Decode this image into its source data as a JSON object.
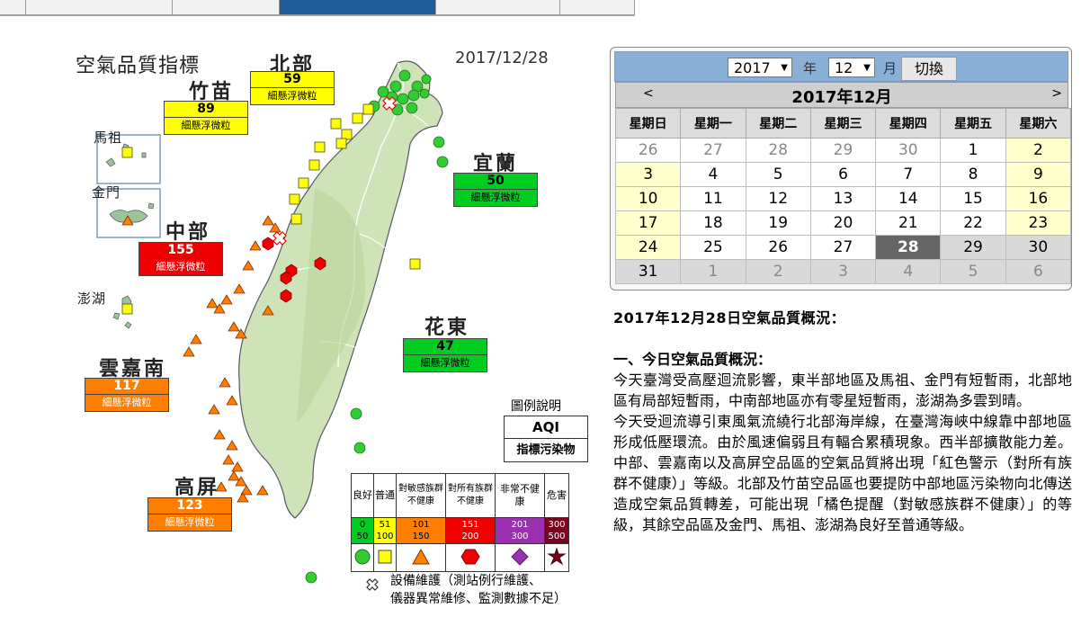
{
  "map": {
    "title": "空氣品質指標",
    "date": "2017/12/28",
    "regions": {
      "north": {
        "name": "北部",
        "aqi": "59",
        "pollutant": "細懸浮微粒"
      },
      "zhumiao": {
        "name": "竹苗",
        "aqi": "89",
        "pollutant": "細懸浮微粒"
      },
      "yilan": {
        "name": "宜蘭",
        "aqi": "50",
        "pollutant": "細懸浮微粒"
      },
      "central": {
        "name": "中部",
        "aqi": "155",
        "pollutant": "細懸浮微粒"
      },
      "hualien": {
        "name": "花東",
        "aqi": "47",
        "pollutant": "細懸浮微粒"
      },
      "yunjianan": {
        "name": "雲嘉南",
        "aqi": "117",
        "pollutant": "細懸浮微粒"
      },
      "gaoping": {
        "name": "高屏",
        "aqi": "123",
        "pollutant": "細懸浮微粒"
      }
    },
    "islands": {
      "matsu": "馬祖",
      "kinmen": "金門",
      "penghu": "澎湖"
    },
    "legend": {
      "title": "圖例說明",
      "aqi": "AQI",
      "pollutant": "指標污染物",
      "levels": [
        {
          "head": "良好",
          "range_lo": "0",
          "range_hi": "50",
          "color": "#00cc22",
          "symbol": "circle"
        },
        {
          "head": "普通",
          "range_lo": "51",
          "range_hi": "100",
          "color": "#ffff00",
          "symbol": "square"
        },
        {
          "head": "對敏感族群不健康",
          "range_lo": "101",
          "range_hi": "150",
          "color": "#ff7e00",
          "symbol": "triangle"
        },
        {
          "head": "對所有族群不健康",
          "range_lo": "151",
          "range_hi": "200",
          "color": "#ee0000",
          "symbol": "hexagon"
        },
        {
          "head": "非常不健康",
          "range_lo": "201",
          "range_hi": "300",
          "color": "#9b30b0",
          "symbol": "diamond"
        },
        {
          "head": "危害",
          "range_lo": "300",
          "range_hi": "500",
          "color": "#7a0020",
          "symbol": "star"
        }
      ],
      "maintenance_line1": "設備維護（測站例行維護、",
      "maintenance_line2": "儀器異常維修、監測數據不足）"
    }
  },
  "calendar": {
    "year": "2017",
    "year_label": "年",
    "month": "12",
    "month_label": "月",
    "switch_label": "切換",
    "prev": "<",
    "next": ">",
    "title": "2017年12月",
    "weekdays": [
      "星期日",
      "星期一",
      "星期二",
      "星期三",
      "星期四",
      "星期五",
      "星期六"
    ],
    "weeks": [
      [
        "26",
        "27",
        "28",
        "29",
        "30",
        "1",
        "2"
      ],
      [
        "3",
        "4",
        "5",
        "6",
        "7",
        "8",
        "9"
      ],
      [
        "10",
        "11",
        "12",
        "13",
        "14",
        "15",
        "16"
      ],
      [
        "17",
        "18",
        "19",
        "20",
        "21",
        "22",
        "23"
      ],
      [
        "24",
        "25",
        "26",
        "27",
        "28",
        "29",
        "30"
      ],
      [
        "31",
        "1",
        "2",
        "3",
        "4",
        "5",
        "6"
      ]
    ],
    "selected": "28"
  },
  "summary": {
    "heading": "2017年12月28日空氣品質概況：",
    "section_title": "一、今日空氣品質概況：",
    "para1": "今天臺灣受高壓迴流影響，東半部地區及馬祖、金門有短暫雨，北部地區有局部短暫雨，中南部地區亦有零星短暫雨，澎湖為多雲到晴。",
    "para2": "今天受迴流導引東風氣流繞行北部海岸線，在臺灣海峽中線靠中部地區形成低壓環流。由於風速偏弱且有輻合累積現象。西半部擴散能力差。中部、雲嘉南以及高屏空品區的空氣品質將出現「紅色警示（對所有族群不健康）」等級。北部及竹苗空品區也要提防中部地區污染物向北傳送造成空氣品質轉差，可能出現「橘色提醒（對敏感族群不健康）」的等級，其餘空品區及金門、馬祖、澎湖為良好至普通等級。"
  }
}
